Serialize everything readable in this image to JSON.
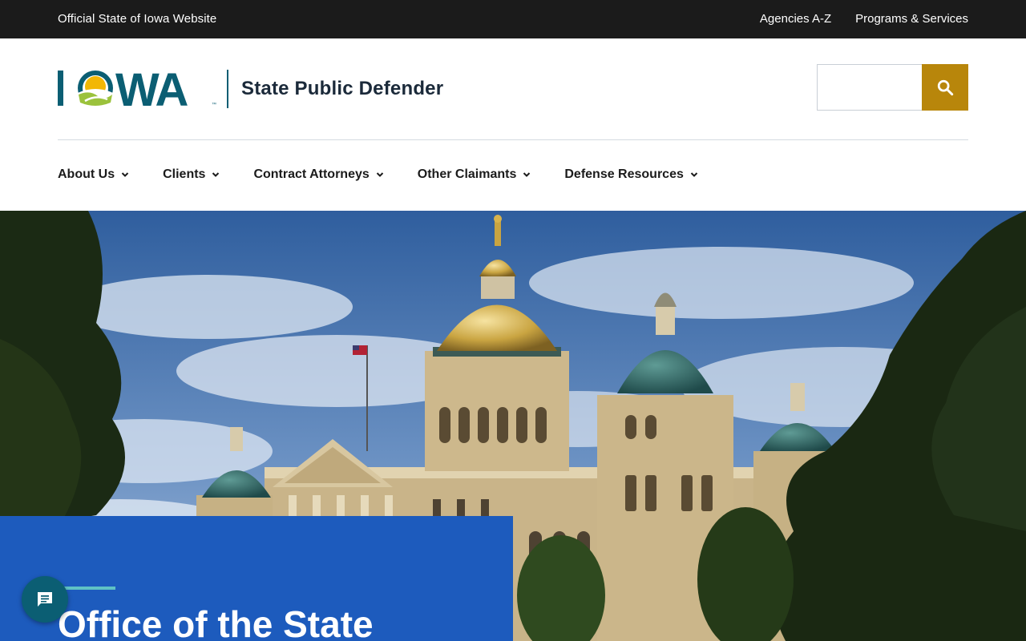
{
  "topbar": {
    "official": "Official State of Iowa Website",
    "links": [
      "Agencies A-Z",
      "Programs & Services"
    ]
  },
  "header": {
    "logo_text": "IOWA",
    "site_name": "State Public Defender",
    "search": {
      "placeholder": "",
      "value": "",
      "icon": "search-icon"
    }
  },
  "nav": {
    "items": [
      {
        "label": "About Us"
      },
      {
        "label": "Clients"
      },
      {
        "label": "Contract Attorneys"
      },
      {
        "label": "Other Claimants"
      },
      {
        "label": "Defense Resources"
      }
    ]
  },
  "hero": {
    "image": "iowa-state-capitol-photo",
    "title": "Office of the State"
  },
  "chat": {
    "icon": "chat-icon"
  },
  "colors": {
    "topbar": "#1b1b1b",
    "brand_teal": "#0b5e73",
    "search_button": "#b8860b",
    "hero_card": "#1d5bbd",
    "accent": "#5fc2c5"
  }
}
